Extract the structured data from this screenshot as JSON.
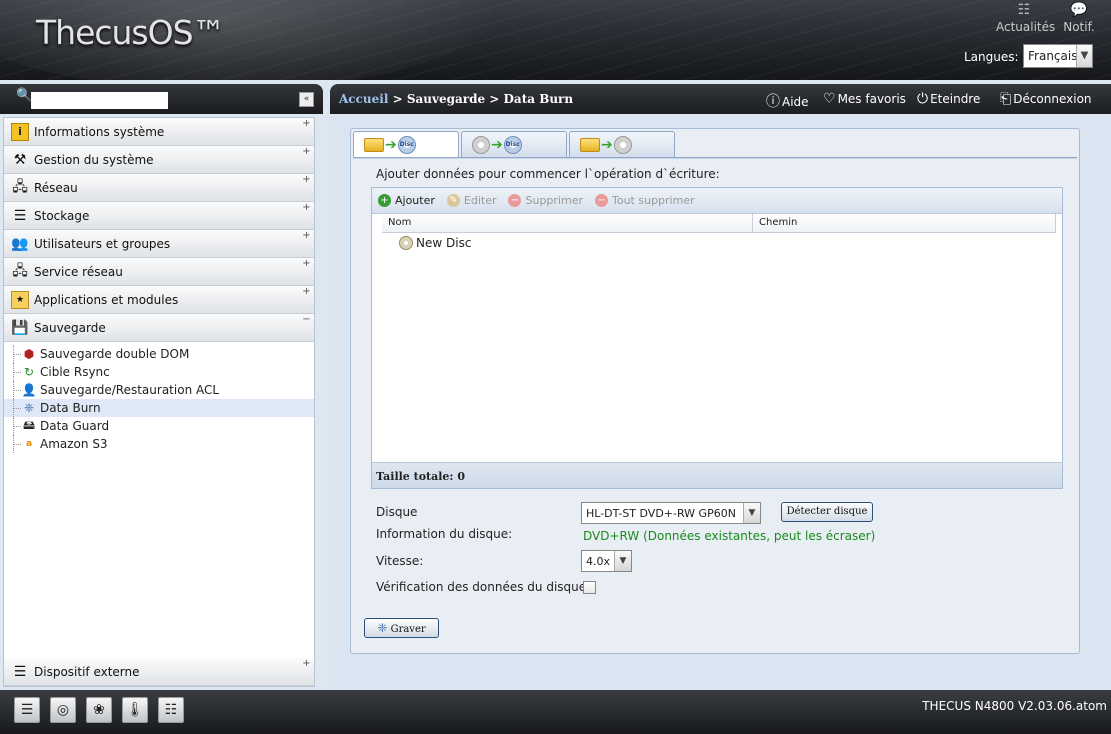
{
  "header": {
    "logo": "ThecusOS™",
    "news_label": "Actualités",
    "notif_label": "Notif.",
    "lang_label": "Langues:",
    "lang_value": "Français"
  },
  "sidebar": {
    "search_placeholder": "",
    "categories": [
      {
        "label": "Informations système",
        "icon": "info-icon",
        "toggle": "+"
      },
      {
        "label": "Gestion du système",
        "icon": "tools-icon",
        "toggle": "+"
      },
      {
        "label": "Réseau",
        "icon": "network-icon",
        "toggle": "+"
      },
      {
        "label": "Stockage",
        "icon": "storage-icon",
        "toggle": "+"
      },
      {
        "label": "Utilisateurs et groupes",
        "icon": "users-icon",
        "toggle": "+"
      },
      {
        "label": "Service réseau",
        "icon": "network-service-icon",
        "toggle": "+"
      },
      {
        "label": "Applications et modules",
        "icon": "apps-icon",
        "toggle": "+"
      },
      {
        "label": "Sauvegarde",
        "icon": "backup-icon",
        "toggle": "−"
      }
    ],
    "sub_items": [
      {
        "label": "Sauvegarde double DOM",
        "icon": "dom-icon"
      },
      {
        "label": "Cible Rsync",
        "icon": "rsync-icon"
      },
      {
        "label": "Sauvegarde/Restauration ACL",
        "icon": "acl-icon"
      },
      {
        "label": "Data Burn",
        "icon": "burn-icon"
      },
      {
        "label": "Data Guard",
        "icon": "guard-icon"
      },
      {
        "label": "Amazon S3",
        "icon": "amazon-icon"
      }
    ],
    "external": {
      "label": "Dispositif externe",
      "toggle": "+"
    }
  },
  "main_header": {
    "breadcrumb_home": "Accueil",
    "breadcrumb_rest": " > Sauvegarde > Data Burn",
    "help": "Aide",
    "favorites": "Mes favoris",
    "shutdown": "Eteindre",
    "logout": "Déconnexion"
  },
  "content": {
    "intro": "Ajouter données pour commencer l`opération d`écriture:",
    "toolbar": {
      "add": "Ajouter",
      "edit": "Editer",
      "delete": "Supprimer",
      "delete_all": "Tout supprimer"
    },
    "columns": [
      "Nom",
      "Chemin"
    ],
    "rows": [
      {
        "name": "New Disc"
      }
    ],
    "total_label": "Taille totale: 0",
    "disk_label": "Disque",
    "disk_value": "HL-DT-ST DVD+-RW GP60N",
    "detect_button": "Détecter disque",
    "disk_info_label": "Information du disque:",
    "disk_info_value": "DVD+RW (Données existantes, peut les écraser)",
    "speed_label": "Vitesse:",
    "speed_value": "4.0x",
    "verify_label": "Vérification des données du disque:",
    "burn_button": "Graver"
  },
  "footer": {
    "version": "THECUS N4800 V2.03.06.atom"
  }
}
